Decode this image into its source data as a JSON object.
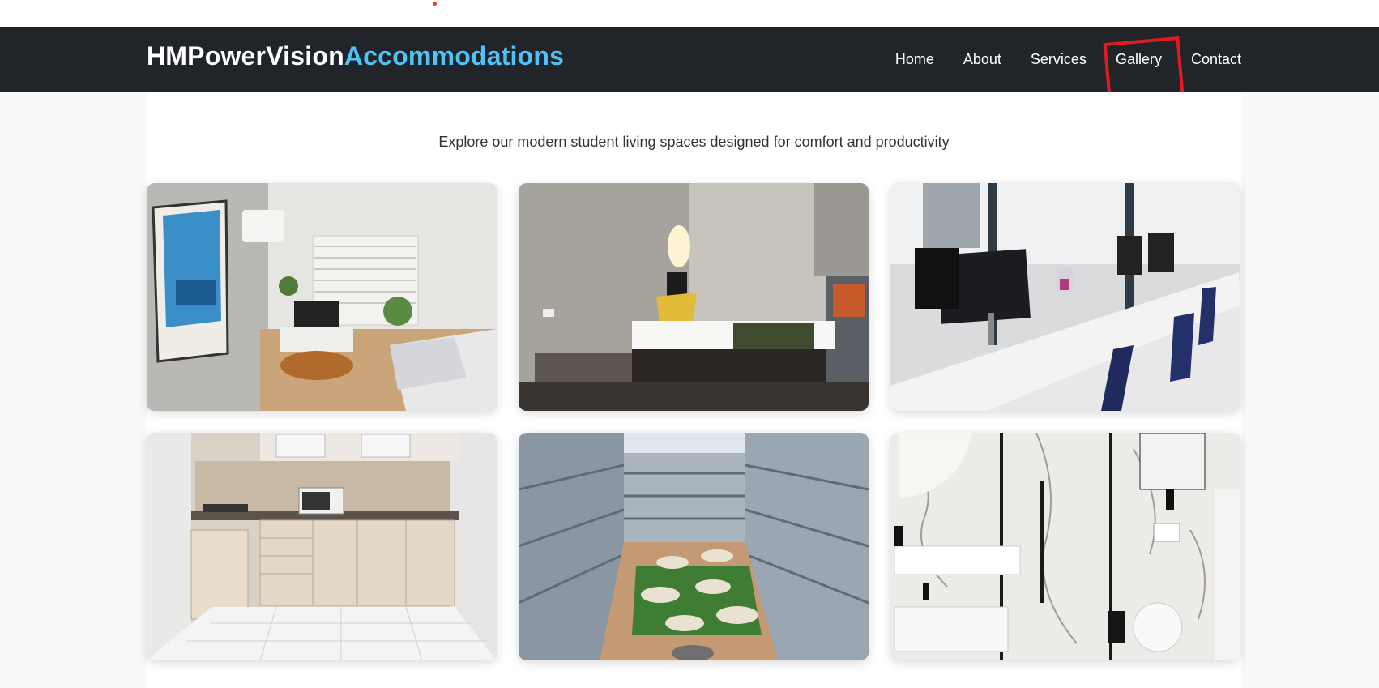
{
  "brand": {
    "part1": "HMPowerVision",
    "part2": "Accommodations"
  },
  "nav": [
    "Home",
    "About",
    "Services",
    "Gallery",
    "Contact"
  ],
  "highlighted_nav": "Gallery",
  "tagline": "Explore our modern student living spaces designed for comfort and productivity",
  "gallery": [
    {
      "icon": "studio-room-photo"
    },
    {
      "icon": "bedroom-photo"
    },
    {
      "icon": "computer-lab-photo"
    },
    {
      "icon": "kitchen-photo"
    },
    {
      "icon": "courtyard-photo"
    },
    {
      "icon": "bathroom-photo"
    }
  ],
  "colors": {
    "navbar": "#212529",
    "brand_accent": "#4fc3f7",
    "highlight_box": "#e01b22",
    "page_bg": "#f8f9fa"
  }
}
